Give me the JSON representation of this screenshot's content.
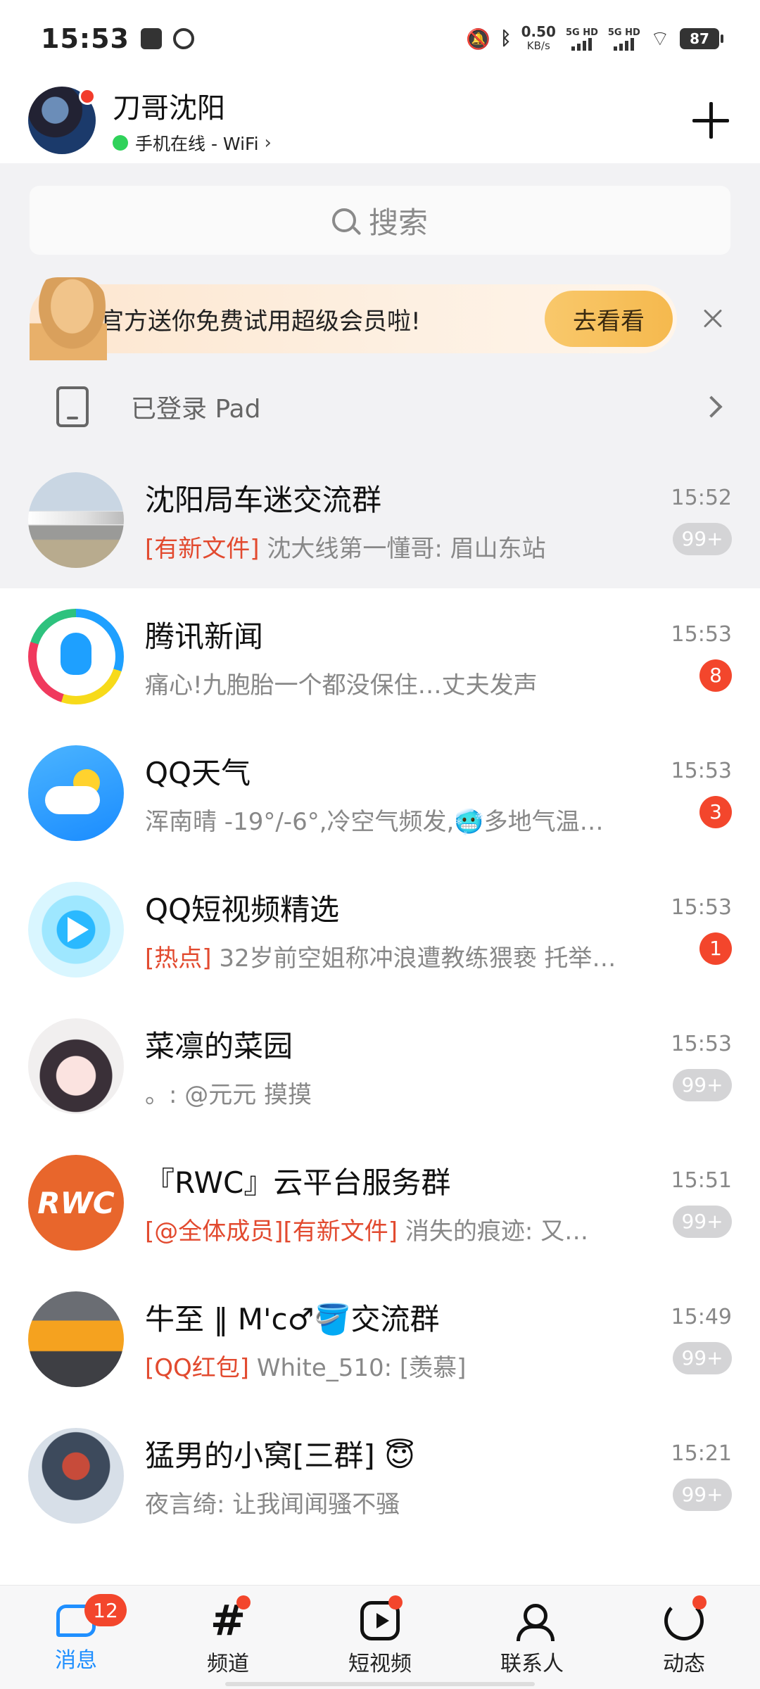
{
  "status_bar": {
    "time": "15:53",
    "speed_value": "0.50",
    "speed_unit": "KB/s",
    "sim1": "5G HD",
    "sim2": "5G HD",
    "battery": "87"
  },
  "header": {
    "name": "刀哥沈阳",
    "status": "手机在线 - WiFi",
    "status_chevron": "›"
  },
  "search": {
    "placeholder": "搜索"
  },
  "promo": {
    "text": "官方送你免费试用超级会员啦!",
    "button": "去看看"
  },
  "pad_row": {
    "label": "已登录 Pad"
  },
  "chats": [
    {
      "name": "沈阳局车迷交流群",
      "tag": "[有新文件]",
      "preview": " 沈大线第一懂哥: 眉山东站",
      "time": "15:52",
      "badge": "99+",
      "muted": true,
      "pinned": true,
      "avatar": "train-photo"
    },
    {
      "name": "腾讯新闻",
      "tag": "",
      "preview": "痛心!九胞胎一个都没保住…丈夫发声",
      "time": "15:53",
      "badge": "8",
      "muted": false,
      "pinned": false,
      "avatar": "tencent-news-logo"
    },
    {
      "name": "QQ天气",
      "tag": "",
      "preview": "浑南晴 -19°/-6°,冷空气频发,🥶多地气温…",
      "time": "15:53",
      "badge": "3",
      "muted": false,
      "pinned": false,
      "avatar": "qq-weather-logo"
    },
    {
      "name": "QQ短视频精选",
      "tag": "[热点]",
      "preview": " 32岁前空姐称冲浪遭教练猥亵 托举…",
      "time": "15:53",
      "badge": "1",
      "muted": false,
      "pinned": false,
      "avatar": "qq-video-logo"
    },
    {
      "name": "菜凛的菜园",
      "tag": "",
      "preview": "。: @元元 摸摸",
      "time": "15:53",
      "badge": "99+",
      "muted": true,
      "pinned": false,
      "avatar": "anime-girl"
    },
    {
      "name": "『RWC』云平台服务群",
      "tag": "[@全体成员][有新文件]",
      "preview": " 消失的痕迹: 又…",
      "time": "15:51",
      "badge": "99+",
      "muted": true,
      "pinned": false,
      "avatar": "rwc-logo",
      "avatar_text": "RWC"
    },
    {
      "name": "牛至 ‖ M'c♂🪣交流群",
      "tag": "[QQ红包]",
      "preview": " White_510: [羡慕]",
      "time": "15:49",
      "badge": "99+",
      "muted": true,
      "pinned": false,
      "avatar": "pixel-art"
    },
    {
      "name": "猛男的小窝[三群] 😇",
      "tag": "",
      "preview": "夜言绮: 让我闻闻骚不骚",
      "time": "15:21",
      "badge": "99+",
      "muted": true,
      "pinned": false,
      "avatar": "warrior-art"
    }
  ],
  "bottom_nav": [
    {
      "label": "消息",
      "icon": "message-icon",
      "active": true,
      "badge": "12"
    },
    {
      "label": "频道",
      "icon": "channel-hash-icon",
      "active": false,
      "dot": true
    },
    {
      "label": "短视频",
      "icon": "short-video-icon",
      "active": false,
      "dot": true
    },
    {
      "label": "联系人",
      "icon": "contacts-icon",
      "active": false
    },
    {
      "label": "动态",
      "icon": "feed-refresh-icon",
      "active": false,
      "dot": true
    }
  ],
  "colors": {
    "accent": "#1f8fff",
    "badge_red": "#f3462c",
    "tag_red": "#e24a2f",
    "online_green": "#2fd25a"
  }
}
